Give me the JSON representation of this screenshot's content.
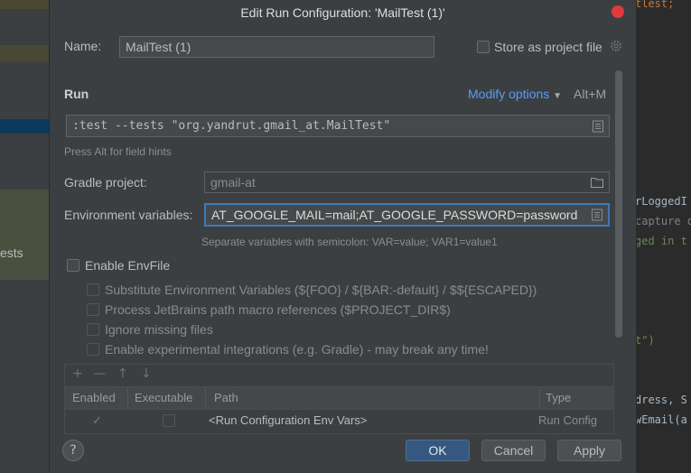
{
  "background": {
    "left_text": "ests",
    "code_lines": [
      "tlest;",
      "rLoggedI",
      "capture o",
      "ged in t",
      "t\")",
      "dress, S",
      "wEmail(a"
    ]
  },
  "dialog": {
    "title": "Edit Run Configuration: 'MailTest (1)'",
    "name_label": "Name:",
    "name_value": "MailTest (1)",
    "store_as_project_file": "Store as project file",
    "run_section": "Run",
    "modify_options": "Modify options",
    "modify_shortcut": "Alt+M",
    "run_command": ":test --tests \"org.yandrut.gmail_at.MailTest\"",
    "field_hint": "Press Alt for field hints",
    "gradle_project_label": "Gradle project:",
    "gradle_project_value": "gmail-at",
    "env_label": "Environment variables:",
    "env_value": "AT_GOOGLE_MAIL=mail;AT_GOOGLE_PASSWORD=password",
    "env_hint": "Separate variables with semicolon: VAR=value; VAR1=value1",
    "enable_envfile": "Enable EnvFile",
    "options": [
      "Substitute Environment Variables (${FOO} / ${BAR:-default} / $${ESCAPED})",
      "Process JetBrains path macro references ($PROJECT_DIR$)",
      "Ignore missing files",
      "Enable experimental integrations (e.g. Gradle) - may break any time!"
    ],
    "table": {
      "headers": [
        "Enabled",
        "Executable",
        "Path",
        "Type"
      ],
      "rows": [
        {
          "path": "<Run Configuration Env Vars>",
          "type": "Run Config",
          "enabled": true,
          "executable": false
        }
      ]
    },
    "buttons": {
      "ok": "OK",
      "cancel": "Cancel",
      "apply": "Apply",
      "help": "?"
    }
  },
  "colors": {
    "accent": "#589df6",
    "primary_button": "#365880",
    "close": "#e0393e"
  }
}
